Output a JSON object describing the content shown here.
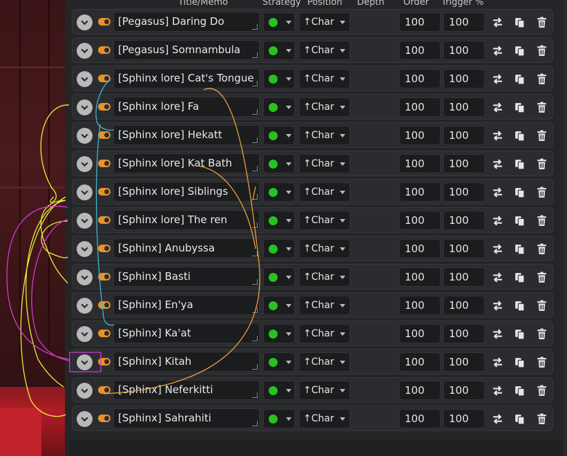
{
  "columns": {
    "title": "Title/Memo",
    "strategy": "Strategy",
    "position": "Position",
    "depth": "Depth",
    "order": "Order",
    "trigger": "Trigger %"
  },
  "entries": [
    {
      "title": "[Pegasus] Daring Do",
      "position": "↑Char",
      "order": "100",
      "trigger": "100"
    },
    {
      "title": "[Pegasus] Somnambula",
      "position": "↑Char",
      "order": "100",
      "trigger": "100"
    },
    {
      "title": "[Sphinx lore] Cat's Tongue",
      "position": "↑Char",
      "order": "100",
      "trigger": "100"
    },
    {
      "title": "[Sphinx lore] Fa",
      "position": "↑Char",
      "order": "100",
      "trigger": "100"
    },
    {
      "title": "[Sphinx lore] Hekatt",
      "position": "↑Char",
      "order": "100",
      "trigger": "100"
    },
    {
      "title": "[Sphinx lore] Kat Bath",
      "position": "↑Char",
      "order": "100",
      "trigger": "100"
    },
    {
      "title": "[Sphinx lore] Siblings",
      "position": "↑Char",
      "order": "100",
      "trigger": "100"
    },
    {
      "title": "[Sphinx lore] The ren",
      "position": "↑Char",
      "order": "100",
      "trigger": "100"
    },
    {
      "title": "[Sphinx] Anubyssa",
      "position": "↑Char",
      "order": "100",
      "trigger": "100"
    },
    {
      "title": "[Sphinx] Basti",
      "position": "↑Char",
      "order": "100",
      "trigger": "100"
    },
    {
      "title": "[Sphinx] En'ya",
      "position": "↑Char",
      "order": "100",
      "trigger": "100"
    },
    {
      "title": "[Sphinx] Ka'at",
      "position": "↑Char",
      "order": "100",
      "trigger": "100"
    },
    {
      "title": "[Sphinx] Kitah",
      "position": "↑Char",
      "order": "100",
      "trigger": "100"
    },
    {
      "title": "[Sphinx] Neferkitti",
      "position": "↑Char",
      "order": "100",
      "trigger": "100"
    },
    {
      "title": "[Sphinx] Sahrahiti",
      "position": "↑Char",
      "order": "100",
      "trigger": "100"
    }
  ],
  "colors": {
    "toggle": "#e8922a",
    "strategy_dot": "#27c222",
    "annotation_yellow": "#e6f23a",
    "annotation_cyan": "#3fb8d8",
    "annotation_orange": "#e8a23a",
    "annotation_magenta": "#d23ad2"
  },
  "icons": [
    "chevron-down-icon",
    "toggle-icon",
    "move-icon",
    "copy-icon",
    "delete-icon"
  ]
}
